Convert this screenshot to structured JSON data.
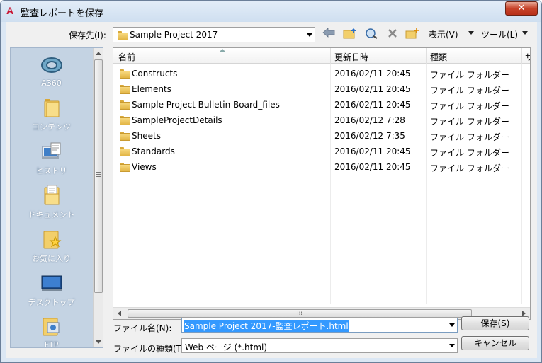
{
  "window": {
    "title": "監査レポートを保存",
    "app_icon": "A",
    "close": "✕"
  },
  "toolbar": {
    "save_in_label": "保存先(I):",
    "location": "Sample Project 2017",
    "view_menu": "表示(V)",
    "tools_menu": "ツール(L)"
  },
  "places": [
    {
      "label": "A360",
      "icon": "a360-icon"
    },
    {
      "label": "コンテンツ",
      "icon": "folder-icon"
    },
    {
      "label": "ヒストリ",
      "icon": "history-icon"
    },
    {
      "label": "ドキュメント",
      "icon": "documents-icon"
    },
    {
      "label": "お気に入り",
      "icon": "favorites-icon"
    },
    {
      "label": "デスクトップ",
      "icon": "desktop-icon"
    },
    {
      "label": "FTP",
      "icon": "ftp-icon"
    }
  ],
  "columns": {
    "name": "名前",
    "date": "更新日時",
    "type": "種類",
    "more": "サ"
  },
  "files": [
    {
      "name": "Constructs",
      "date": "2016/02/11 20:45",
      "type": "ファイル フォルダー"
    },
    {
      "name": "Elements",
      "date": "2016/02/11 20:45",
      "type": "ファイル フォルダー"
    },
    {
      "name": "Sample Project Bulletin Board_files",
      "date": "2016/02/11 20:45",
      "type": "ファイル フォルダー"
    },
    {
      "name": "SampleProjectDetails",
      "date": "2016/02/12 7:28",
      "type": "ファイル フォルダー"
    },
    {
      "name": "Sheets",
      "date": "2016/02/12 7:35",
      "type": "ファイル フォルダー"
    },
    {
      "name": "Standards",
      "date": "2016/02/11 20:45",
      "type": "ファイル フォルダー"
    },
    {
      "name": "Views",
      "date": "2016/02/11 20:45",
      "type": "ファイル フォルダー"
    }
  ],
  "form": {
    "filename_label": "ファイル名(N):",
    "filename_value": "Sample Project 2017-監査レポート.html",
    "filetype_label": "ファイルの種類(T):",
    "filetype_value": "Web ページ (*.html)",
    "save_button": "保存(S)",
    "cancel_button": "キャンセル"
  },
  "colors": {
    "title_bg": "#dbe7f4",
    "places_bg": "#c4d3e3",
    "close_red": "#c7432a",
    "selection": "#3399ff",
    "folder_yellow": "#f2cf6b"
  }
}
